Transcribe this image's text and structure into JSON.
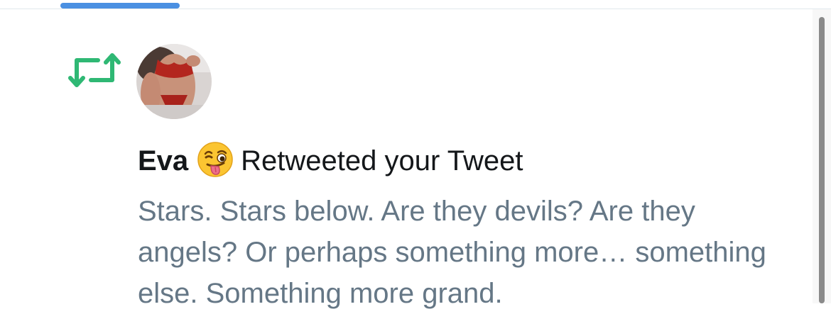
{
  "colors": {
    "accent": "#4a90e2",
    "retweet_green": "#2fb874",
    "name_text": "#14171a",
    "tweet_text": "#657786"
  },
  "notification": {
    "icon": "retweet-icon",
    "user_name": "Eva",
    "emoji": "winking-face-with-tongue",
    "action": "Retweeted your Tweet",
    "tweet_text": "Stars. Stars below. Are they devils? Are they angels? Or perhaps something more… something else. Something more grand."
  }
}
